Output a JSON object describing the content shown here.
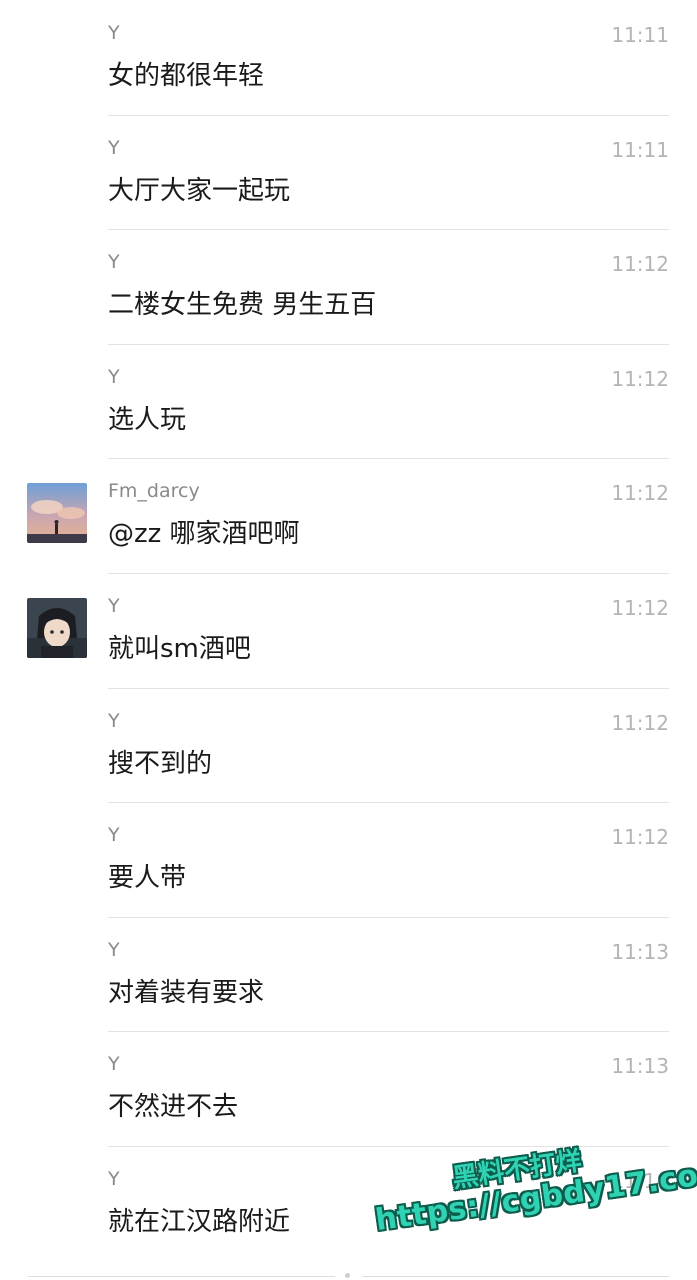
{
  "messages": [
    {
      "sender": "Y",
      "time": "11:11",
      "text": "女的都很年轻",
      "avatar": null
    },
    {
      "sender": "Y",
      "time": "11:11",
      "text": "大厅大家一起玩",
      "avatar": null
    },
    {
      "sender": "Y",
      "time": "11:12",
      "text": "二楼女生免费 男生五百",
      "avatar": null
    },
    {
      "sender": "Y",
      "time": "11:12",
      "text": "选人玩",
      "avatar": null
    },
    {
      "sender": "Fm_darcy",
      "time": "11:12",
      "text": "@zz 哪家酒吧啊",
      "avatar": "sky-avatar"
    },
    {
      "sender": "Y",
      "time": "11:12",
      "text": "就叫sm酒吧",
      "avatar": "anime-avatar"
    },
    {
      "sender": "Y",
      "time": "11:12",
      "text": "搜不到的",
      "avatar": null
    },
    {
      "sender": "Y",
      "time": "11:12",
      "text": "要人带",
      "avatar": null
    },
    {
      "sender": "Y",
      "time": "11:13",
      "text": "对着装有要求",
      "avatar": null
    },
    {
      "sender": "Y",
      "time": "11:13",
      "text": "不然进不去",
      "avatar": null
    },
    {
      "sender": "Y",
      "time": "11:14",
      "text": "就在江汉路附近",
      "avatar": null
    }
  ],
  "watermark": {
    "line1": "黑料不打烊",
    "line2": "https://cgbdy17.com"
  }
}
